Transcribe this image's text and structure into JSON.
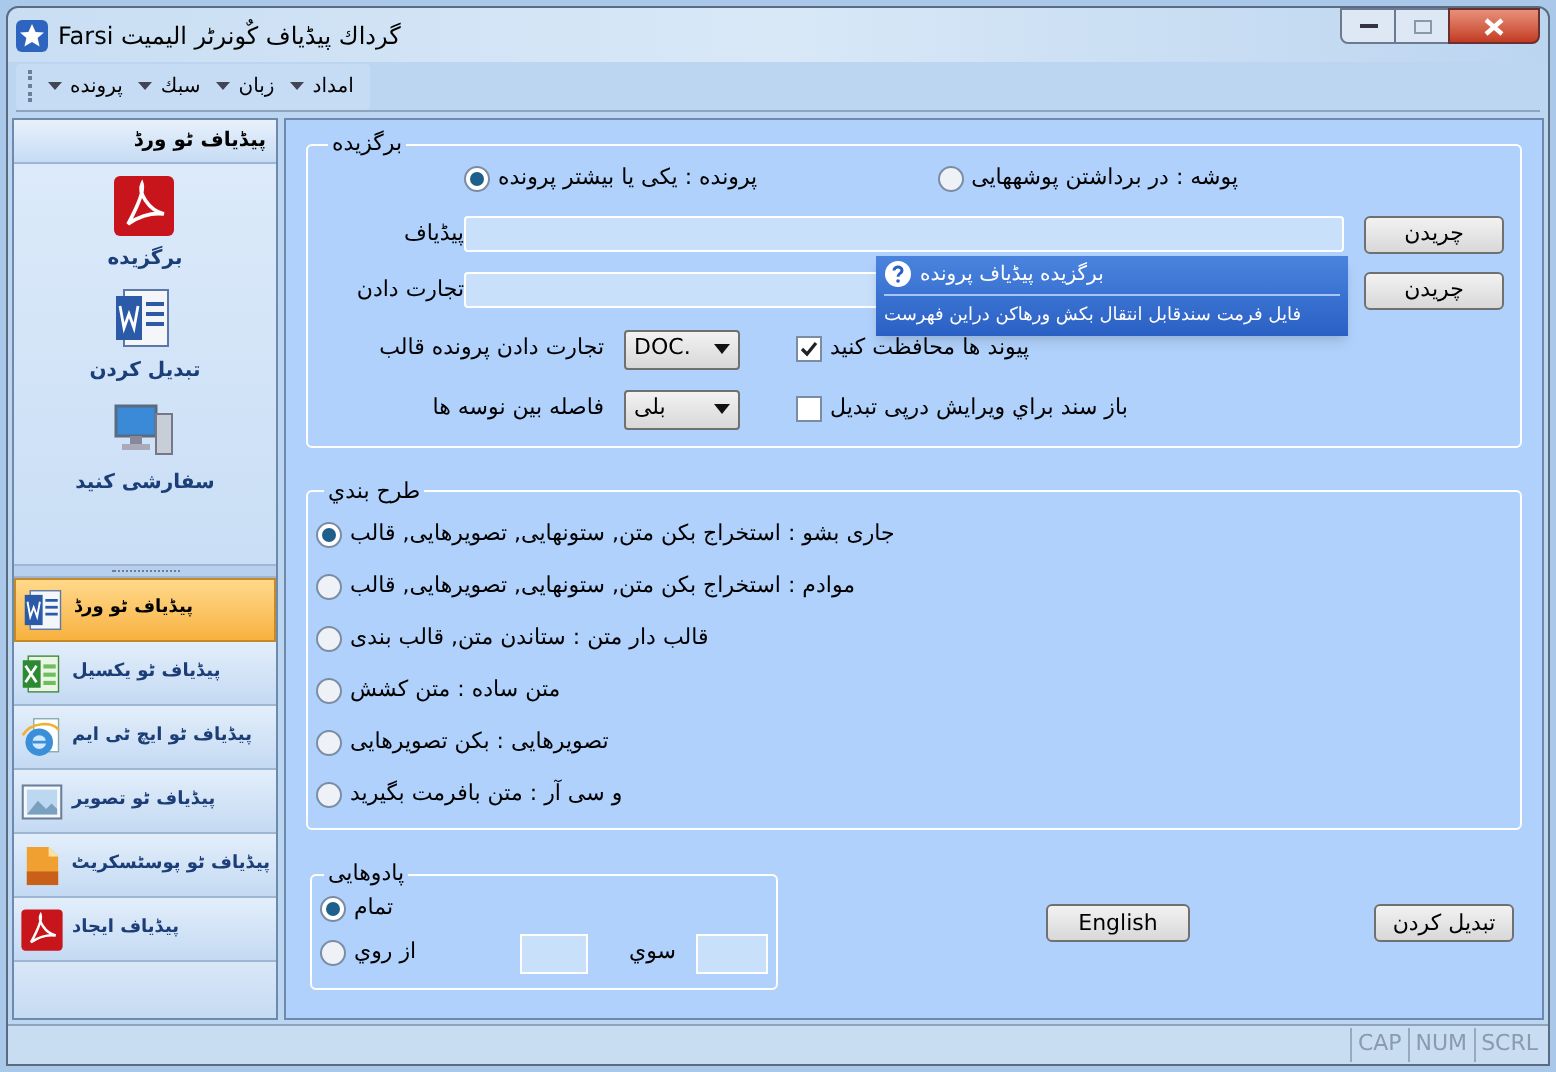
{
  "window": {
    "title": "گرداك پیڈیاف كٌونرٹر الیمیت Farsi"
  },
  "menu": [
    {
      "label": "امداد"
    },
    {
      "label": "زبان"
    },
    {
      "label": "سبك"
    },
    {
      "label": "پرونده"
    }
  ],
  "sidebar": {
    "title": "پیڈیاف ٹو ورڈ",
    "actions": [
      {
        "label": "برگزیده",
        "kind": "pdf"
      },
      {
        "label": "تبدیل كردن",
        "kind": "word"
      },
      {
        "label": "سفارشی كنید",
        "kind": "computer"
      }
    ],
    "items": [
      {
        "label": "پیڈیاف ٹو ورڈ",
        "kind": "word",
        "selected": true
      },
      {
        "label": "پیڈیاف ٹو یكسیل",
        "kind": "excel",
        "selected": false
      },
      {
        "label": "پیڈیاف ٹو ایچ ٹی ایم",
        "kind": "html",
        "selected": false
      },
      {
        "label": "پیڈیاف ٹو تصویر",
        "kind": "image",
        "selected": false
      },
      {
        "label": "پیڈیاف ٹو پوسٹسكریٹ",
        "kind": "postscript",
        "selected": false
      },
      {
        "label": "پیڈیاف ایجاد",
        "kind": "pdf",
        "selected": false
      }
    ]
  },
  "source": {
    "title": "برگزیده",
    "modes": [
      {
        "label": "پوشه : در برداشتن پوشههایی",
        "selected": false
      },
      {
        "label": "پرونده : یكی یا بیشتر پرونده",
        "selected": true
      }
    ],
    "fields": [
      {
        "label": "پیڈیاف",
        "button": "چریدن"
      },
      {
        "label": "تجارت دادن",
        "button": "چریدن"
      }
    ],
    "tooltip": {
      "title": "برگزیده پیڈیاف پرونده",
      "text": "فایل فرمت سندقابل انتقال بكش ورهاكن دراین فهرست"
    },
    "options": [
      {
        "label": "تجارت دادن پرونده قالب",
        "value": ".DOC",
        "check_label": "پیوند ها محافظت كنید",
        "checked": true
      },
      {
        "label": "فاصله بین نوسه ها",
        "value": "بلی",
        "check_label": "باز سند براي ویرایش درپی تبدیل",
        "checked": false
      }
    ]
  },
  "layout": {
    "title": "طرح بندي",
    "options": [
      {
        "label": "جاری بشو :  استخراج بكن متن, ستونهایی, تصویرهایی, قالب",
        "selected": true
      },
      {
        "label": "موادم :  استخراج بكن متن, ستونهایی, تصویرهایی, قالب",
        "selected": false
      },
      {
        "label": "قالب دار متن :  ستاندن متن, قالب بندی",
        "selected": false
      },
      {
        "label": "متن ساده :  متن كشش",
        "selected": false
      },
      {
        "label": "تصویرهایی :  بكن تصویرهایی",
        "selected": false
      },
      {
        "label": "و سی آر :  متن بافرمت بگیرید",
        "selected": false
      }
    ]
  },
  "pages": {
    "title": "پادوهایی",
    "all": {
      "label": "تمام",
      "selected": true
    },
    "range": {
      "label": "از روي",
      "selected": false,
      "to_label": "سوي"
    }
  },
  "buttons": {
    "language": "English",
    "convert": "تبدیل كردن"
  },
  "status_bar": [
    "SCRL",
    "NUM",
    "CAP"
  ]
}
